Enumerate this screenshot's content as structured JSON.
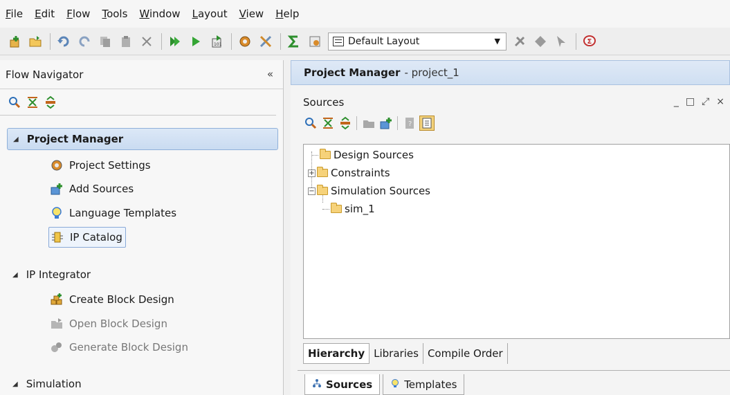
{
  "menu": [
    "File",
    "Edit",
    "Flow",
    "Tools",
    "Window",
    "Layout",
    "View",
    "Help"
  ],
  "toolbar": {
    "layout_select": "Default Layout",
    "icons": [
      "new-project-icon",
      "open-project-icon",
      "undo-icon",
      "redo-icon",
      "copy-icon",
      "paste-icon",
      "delete-icon",
      "run-simulation-icon",
      "run-icon",
      "generate-bitstream-icon",
      "settings-icon",
      "tools-icon",
      "sigma-icon",
      "report-icon",
      "pin-icon",
      "diamond-icon",
      "cursor-icon",
      "help-icon"
    ]
  },
  "flow_navigator": {
    "title": "Flow Navigator",
    "collapse": "«",
    "sections": [
      {
        "label": "Project Manager",
        "active": true,
        "items": [
          {
            "label": "Project Settings",
            "icon": "gear-icon"
          },
          {
            "label": "Add Sources",
            "icon": "add-sources-icon"
          },
          {
            "label": "Language Templates",
            "icon": "lightbulb-icon"
          },
          {
            "label": "IP Catalog",
            "icon": "ip-chip-icon"
          }
        ]
      },
      {
        "label": "IP Integrator",
        "items": [
          {
            "label": "Create Block Design",
            "icon": "create-block-icon"
          },
          {
            "label": "Open Block Design",
            "icon": "open-block-icon",
            "disabled": true
          },
          {
            "label": "Generate Block Design",
            "icon": "generate-block-icon",
            "disabled": true
          }
        ]
      },
      {
        "label": "Simulation",
        "items": []
      }
    ]
  },
  "project_manager": {
    "title": "Project Manager",
    "project_name": "- project_1",
    "sources": {
      "title": "Sources",
      "window_controls": [
        "_",
        "□",
        "⤢",
        "×"
      ],
      "tree": [
        {
          "label": "Design Sources",
          "level": 0
        },
        {
          "label": "Constraints",
          "level": 0,
          "expander": "+"
        },
        {
          "label": "Simulation Sources",
          "level": 0,
          "expander": "−"
        },
        {
          "label": "sim_1",
          "level": 1
        }
      ],
      "view_tabs": [
        "Hierarchy",
        "Libraries",
        "Compile Order"
      ],
      "bottom_tabs": [
        {
          "label": "Sources",
          "icon": "hierarchy-icon"
        },
        {
          "label": "Templates",
          "icon": "lightbulb-icon"
        }
      ]
    }
  }
}
